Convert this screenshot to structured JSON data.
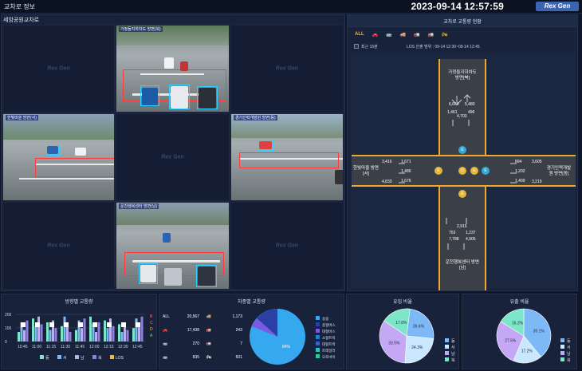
{
  "header": {
    "title": "교차로 정보",
    "clock": "2023-09-14 12:57:59",
    "logo": "Rex Gen"
  },
  "left": {
    "intersection": "세암공원교차로",
    "watermark": "Rex Gen",
    "cams": {
      "north": "가정들지하차도 방면(북)",
      "west": "한빛마을 방면(서)",
      "east": "경기인력개발원 방면(동)",
      "south": "운천행복센터 방면(남)"
    }
  },
  "traffic": {
    "title": "교차로 교통량 현황",
    "tabs": [
      "ALL",
      "🚗",
      "🚌",
      "🚚",
      "🚛",
      "🚛",
      "🏍"
    ],
    "recent": "최근 15분",
    "range": "LOS 산출 범위 : 09-14 12:30~09-14 12:45",
    "north": {
      "label": "가정들지하차도 방면[북]",
      "a": "6,660",
      "b": "5,480",
      "c": "1,461",
      "d": "496",
      "e": "4,703"
    },
    "west": {
      "label": "한빛마을 방면[서]",
      "a": "3,416",
      "b": "1,671",
      "c": "1,486",
      "d": "4,833",
      "e": "1,676"
    },
    "east": {
      "label": "경기인력개발원 방면[동]",
      "a": "894",
      "b": "3,605",
      "c": "1,202",
      "d": "1,409",
      "e": "3,219"
    },
    "south": {
      "label": "운천행복센터 방면[남]",
      "a": "2,915",
      "b": "753",
      "c": "1,237",
      "d": "7,788",
      "e": "4,905"
    },
    "lights": [
      "E",
      "E",
      "D",
      "E",
      "E",
      "E"
    ]
  },
  "bottom": {
    "direction": {
      "title": "방향별 교통량",
      "yticks": [
        "200",
        "100",
        "0"
      ],
      "times": [
        "10:45",
        "11:00",
        "11:15",
        "11:30",
        "11:45",
        "12:00",
        "12:15",
        "12:30",
        "12:45"
      ],
      "los_labels": [
        "B",
        "C",
        "D",
        "A"
      ],
      "legend": [
        "동",
        "서",
        "남",
        "북",
        "LOS"
      ]
    },
    "vehicle": {
      "title": "차종별 교통량",
      "rows": [
        {
          "l": "ALL",
          "v": "20,567",
          "r": "1,173"
        },
        {
          "l": "",
          "v": "17,438",
          "r": "243"
        },
        {
          "l": "",
          "v": "270",
          "r": "7"
        },
        {
          "l": "",
          "v": "835",
          "r": "601"
        }
      ],
      "pie_label": "84%",
      "legend": [
        "승용",
        "중형버스",
        "대형버스",
        "소형트럭",
        "대형트럭",
        "트레일러",
        "오토바이"
      ]
    },
    "inflow": {
      "title": "유입 비율",
      "values": [
        {
          "v": 26.6,
          "l": "26.6%",
          "c": "#7db8f7"
        },
        {
          "v": 24.3,
          "l": "24.3%",
          "c": "#c9e8ff"
        },
        {
          "v": 33.5,
          "l": "33.5%",
          "c": "#c5a8f5"
        },
        {
          "v": 17.6,
          "l": "17.6%",
          "c": "#7ee6c8"
        }
      ],
      "legend": [
        "동",
        "서",
        "남",
        "북"
      ]
    },
    "outflow": {
      "title": "유출 비율",
      "values": [
        {
          "v": 39.1,
          "l": "39.1%",
          "c": "#7db8f7"
        },
        {
          "v": 17.2,
          "l": "17.2%",
          "c": "#c9e8ff"
        },
        {
          "v": 27.5,
          "l": "27.5%",
          "c": "#c5a8f5"
        },
        {
          "v": 16.2,
          "l": "16.2%",
          "c": "#7ee6c8"
        }
      ],
      "legend": [
        "동",
        "서",
        "남",
        "북"
      ]
    }
  }
}
